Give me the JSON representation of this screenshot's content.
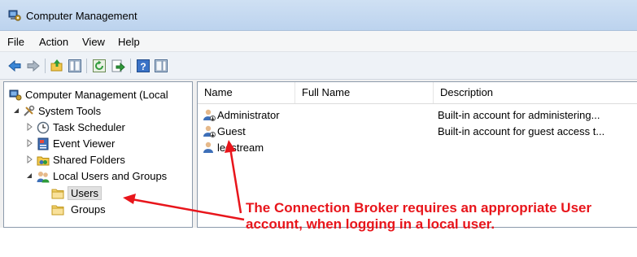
{
  "window": {
    "title": "Computer Management"
  },
  "menu": [
    "File",
    "Action",
    "View",
    "Help"
  ],
  "toolbar": {
    "buttons": [
      "back-icon",
      "forward-icon",
      "up-icon",
      "show-hide-tree-icon",
      "refresh-icon",
      "export-icon",
      "help-icon",
      "show-hide-action-pane-icon"
    ]
  },
  "tree": {
    "root": "Computer Management (Local",
    "system_tools": "System Tools",
    "task_scheduler": "Task Scheduler",
    "event_viewer": "Event Viewer",
    "shared_folders": "Shared Folders",
    "local_users_groups": "Local Users and Groups",
    "users": "Users",
    "groups": "Groups"
  },
  "list": {
    "columns": [
      "Name",
      "Full Name",
      "Description"
    ],
    "rows": [
      {
        "name": "Administrator",
        "full_name": "",
        "description": "Built-in account for administering..."
      },
      {
        "name": "Guest",
        "full_name": "",
        "description": "Built-in account for guest access t..."
      },
      {
        "name": "leostream",
        "full_name": "",
        "description": ""
      }
    ]
  },
  "annotation": {
    "line1": "The Connection Broker requires an appropriate User",
    "line2": "account, when logging in a local user.",
    "color": "#e8151b"
  },
  "colors": {
    "titlebar": "#c6dbf3",
    "selection": "#e1e1e1",
    "border": "#8c9aab"
  }
}
